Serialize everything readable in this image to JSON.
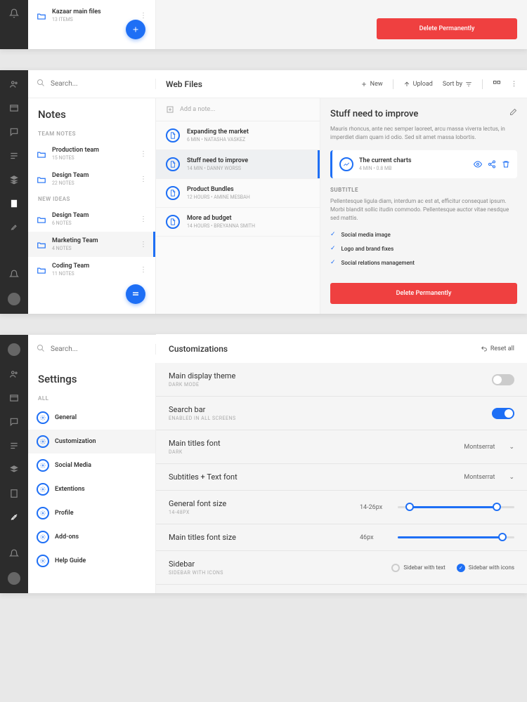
{
  "panel1": {
    "file": {
      "name": "Kazaar main files",
      "meta": "13 ITEMS"
    },
    "delete_btn": "Delete Permanently"
  },
  "panel2": {
    "search_placeholder": "Search...",
    "title": "Web Files",
    "actions": {
      "new": "New",
      "upload": "Upload",
      "sort": "Sort by"
    },
    "notes_title": "Notes",
    "team_notes_label": "TEAM NOTES",
    "new_ideas_label": "NEW IDEAS",
    "folders_a": [
      {
        "name": "Production team",
        "meta": "15 NOTES"
      },
      {
        "name": "Design Team",
        "meta": "22 NOTES"
      }
    ],
    "folders_b": [
      {
        "name": "Design Team",
        "meta": "6 NOTES"
      },
      {
        "name": "Marketing Team",
        "meta": "4 NOTES"
      },
      {
        "name": "Coding Team",
        "meta": "11 NOTES"
      }
    ],
    "addnote_placeholder": "Add a note...",
    "notes": [
      {
        "title": "Expanding the market",
        "meta": "6 MIN  •  NATASHA VASKEZ"
      },
      {
        "title": "Stuff need to improve",
        "meta": "14 MIN  •  DANNY WORSS"
      },
      {
        "title": "Product Bundles",
        "meta": "12 HOURS  •  AMINE MESBAH"
      },
      {
        "title": "More ad budget",
        "meta": "14 HOURS  •  BREYANNA SMITH"
      }
    ],
    "detail": {
      "title": "Stuff need to improve",
      "desc": "Mauris rhoncus, ante nec semper laoreet, arcu massa viverra lectus, in imperdiet diam quam id odio. Sed sit amet massa lobortis.",
      "card_title": "The current charts",
      "card_meta": "4 MIN  •  0.8 MB",
      "subtitle": "SUBTITLE",
      "subdesc": "Pellentesque ligula diam, interdum ac est at, efficitur consequat ipsum. Morbi blandit sollic itudin commodo. Pellentesque auctor vitae nesdque sed mattis.",
      "checks": [
        "Social media image",
        "Logo and brand fixes",
        "Social relations management"
      ],
      "delete_btn": "Delete Permanently"
    }
  },
  "panel3": {
    "search_placeholder": "Search...",
    "settings_title": "Settings",
    "all_label": "ALL",
    "items": [
      "General",
      "Customization",
      "Social Media",
      "Extentions",
      "Profile",
      "Add-ons",
      "Help Guide"
    ],
    "main_title": "Customizations",
    "reset": "Reset all",
    "rows": {
      "theme": {
        "label": "Main display theme",
        "sub": "DARK MODE"
      },
      "searchbar": {
        "label": "Search bar",
        "sub": "ENABLED IN ALL SCREENS"
      },
      "titlefont": {
        "label": "Main titles font",
        "sub": "DARK",
        "value": "Montserrat"
      },
      "subfont": {
        "label": "Subtitles + Text font",
        "value": "Montserrat"
      },
      "gensize": {
        "label": "General font size",
        "sub": "14-48PX",
        "value": "14-26px"
      },
      "titlesize": {
        "label": "Main titles font size",
        "value": "46px"
      },
      "sidebar": {
        "label": "Sidebar",
        "sub": "SIDEBAR WITH ICONS",
        "opt1": "Sidebar with text",
        "opt2": "Sidebar with icons"
      }
    }
  }
}
